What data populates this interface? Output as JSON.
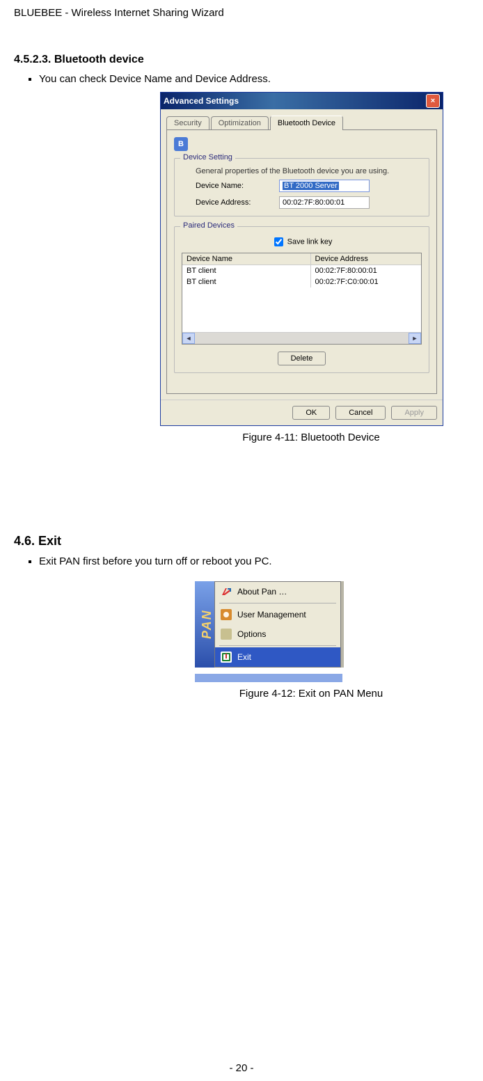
{
  "doc_header": "BLUEBEE - Wireless Internet Sharing Wizard",
  "section_4523": {
    "heading": "4.5.2.3. Bluetooth device",
    "bullet": "You can check Device Name and Device Address."
  },
  "dialog": {
    "title": "Advanced Settings",
    "tabs": {
      "security": "Security",
      "optimization": "Optimization",
      "bluetooth": "Bluetooth Device"
    },
    "device_setting": {
      "legend": "Device Setting",
      "desc": "General properties of the Bluetooth device you are using.",
      "name_label": "Device Name:",
      "name_value": "BT 2000 Server",
      "addr_label": "Device Address:",
      "addr_value": "00:02:7F:80:00:01"
    },
    "paired": {
      "legend": "Paired Devices",
      "save_link_key": "Save link key",
      "col_name": "Device Name",
      "col_addr": "Device Address",
      "rows": [
        {
          "name": "BT client",
          "addr": "00:02:7F:80:00:01"
        },
        {
          "name": "BT client",
          "addr": "00:02:7F:C0:00:01"
        }
      ],
      "delete_btn": "Delete"
    },
    "buttons": {
      "ok": "OK",
      "cancel": "Cancel",
      "apply": "Apply"
    }
  },
  "fig411": "Figure 4-11: Bluetooth Device",
  "section_46": {
    "heading": "4.6. Exit",
    "bullet": "Exit PAN first before you turn off or reboot you PC."
  },
  "pan_menu": {
    "sidebar": "PAN",
    "about": "About Pan …",
    "user_mgmt": "User Management",
    "options": "Options",
    "exit": "Exit"
  },
  "fig412": "Figure 4-12: Exit on PAN Menu",
  "page_footer": "- 20 -"
}
